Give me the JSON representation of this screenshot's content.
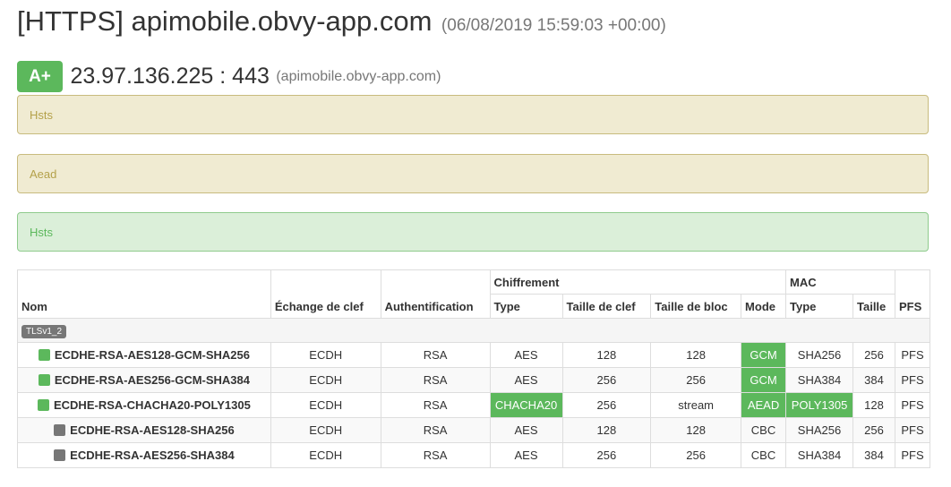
{
  "header": {
    "title": "[HTTPS] apimobile.obvy-app.com",
    "date": "(06/08/2019 15:59:03 +00:00)"
  },
  "grade": {
    "badge": "A+",
    "endpoint": "23.97.136.225 : 443",
    "host": "(apimobile.obvy-app.com)"
  },
  "alerts": [
    {
      "text": "Hsts",
      "level": "warning"
    },
    {
      "text": "Aead",
      "level": "warning"
    },
    {
      "text": "Hsts",
      "level": "success"
    }
  ],
  "table": {
    "headers": {
      "nom": "Nom",
      "echange": "Échange de clef",
      "auth": "Authentification",
      "chiffrement": "Chiffrement",
      "type": "Type",
      "taille_clef": "Taille de clef",
      "taille_bloc": "Taille de bloc",
      "mode": "Mode",
      "mac": "MAC",
      "mac_type": "Type",
      "mac_taille": "Taille",
      "pfs": "PFS"
    },
    "group": "TLSv1_2",
    "rows": [
      {
        "name": "ECDHE-RSA-AES128-GCM-SHA256",
        "status": "good",
        "kx": "ECDH",
        "auth": "RSA",
        "enc": "AES",
        "key": "128",
        "block": "128",
        "mode": "GCM",
        "mac": "SHA256",
        "macsize": "256",
        "pfs": "PFS"
      },
      {
        "name": "ECDHE-RSA-AES256-GCM-SHA384",
        "status": "good",
        "kx": "ECDH",
        "auth": "RSA",
        "enc": "AES",
        "key": "256",
        "block": "256",
        "mode": "GCM",
        "mac": "SHA384",
        "macsize": "384",
        "pfs": "PFS"
      },
      {
        "name": "ECDHE-RSA-CHACHA20-POLY1305",
        "status": "good",
        "kx": "ECDH",
        "auth": "RSA",
        "enc": "CHACHA20",
        "key": "256",
        "block": "stream",
        "mode": "AEAD",
        "mac": "POLY1305",
        "macsize": "128",
        "pfs": "PFS"
      },
      {
        "name": "ECDHE-RSA-AES128-SHA256",
        "status": "neutral",
        "kx": "ECDH",
        "auth": "RSA",
        "enc": "AES",
        "key": "128",
        "block": "128",
        "mode": "CBC",
        "mac": "SHA256",
        "macsize": "256",
        "pfs": "PFS"
      },
      {
        "name": "ECDHE-RSA-AES256-SHA384",
        "status": "neutral",
        "kx": "ECDH",
        "auth": "RSA",
        "enc": "AES",
        "key": "256",
        "block": "256",
        "mode": "CBC",
        "mac": "SHA384",
        "macsize": "384",
        "pfs": "PFS"
      }
    ]
  },
  "colors": {
    "success": "#5cb85c",
    "warning_bg": "#f0ebd2",
    "success_bg": "#dbefd9",
    "neutral": "#777777"
  }
}
